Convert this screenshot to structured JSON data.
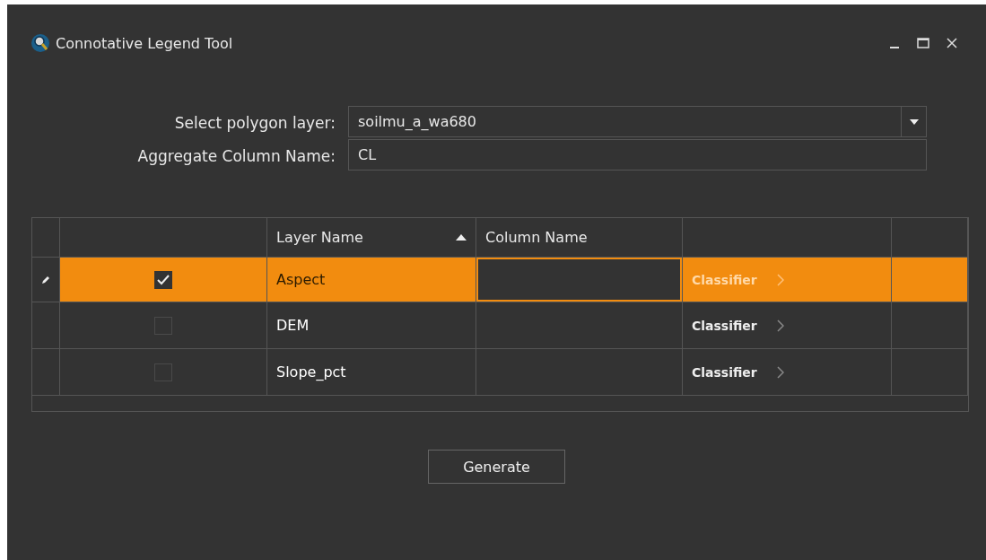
{
  "window": {
    "title": "Connotative Legend Tool"
  },
  "fields": [
    {
      "kind": "dropdown",
      "label": "Select polygon layer:",
      "value": "soilmu_a_wa680"
    },
    {
      "kind": "text",
      "label": "Aggregate Column Name:",
      "value": "CL"
    }
  ],
  "table": {
    "columns": [
      {
        "label": "Layer Name",
        "sorted": true
      },
      {
        "label": "Column Name",
        "sorted": false
      }
    ],
    "rows": [
      {
        "selected": true,
        "editing": true,
        "checked": true,
        "layer": "Aspect",
        "action": "Classifier"
      },
      {
        "selected": false,
        "editing": false,
        "checked": false,
        "layer": "DEM",
        "action": "Classifier"
      },
      {
        "selected": false,
        "editing": false,
        "checked": false,
        "layer": "Slope_pct",
        "action": "Classifier"
      }
    ]
  },
  "buttons": [
    {
      "label": "Generate"
    }
  ]
}
